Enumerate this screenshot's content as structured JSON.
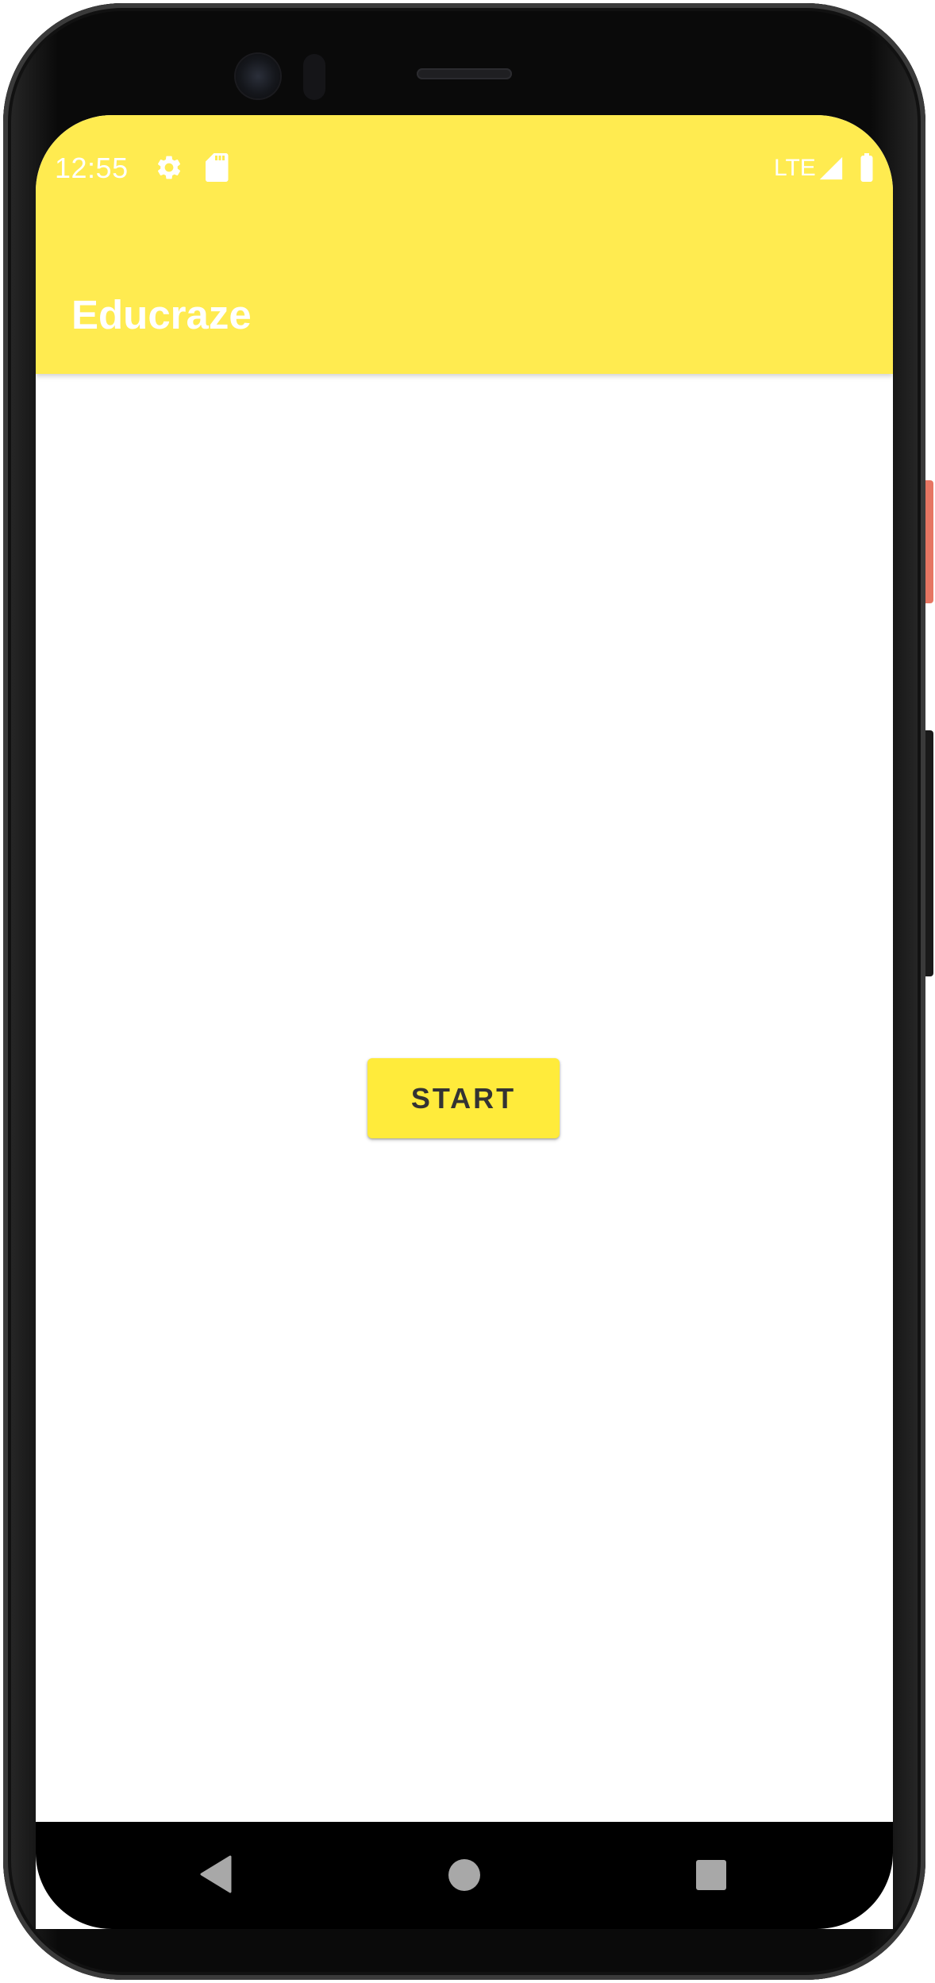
{
  "status_bar": {
    "time": "12:55",
    "icons": [
      "settings-icon",
      "sd-card-icon"
    ],
    "network": "LTE",
    "right_icons": [
      "signal-icon",
      "battery-icon"
    ]
  },
  "app_bar": {
    "title": "Educraze",
    "color": "#ffeb50"
  },
  "main": {
    "start_button_label": "START",
    "start_button_color": "#ffeb3b"
  },
  "nav_bar": {
    "buttons": [
      "back-icon",
      "home-icon",
      "recents-icon"
    ]
  }
}
